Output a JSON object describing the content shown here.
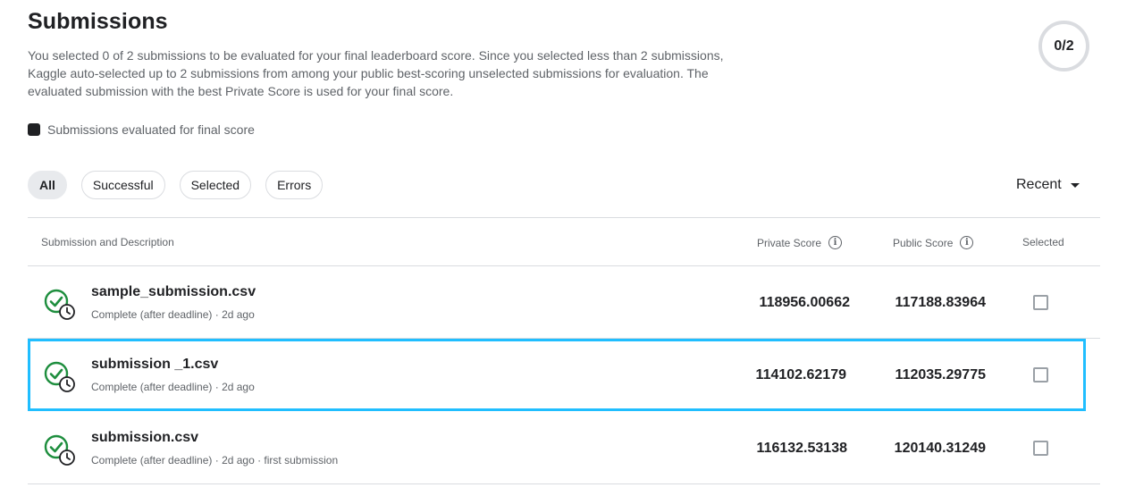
{
  "header": {
    "title": "Submissions",
    "description_lines": [
      "You selected 0 of 2 submissions to be evaluated for your final leaderboard score. Since you selected less than 2 submissions,",
      "Kaggle auto-selected up to 2 submissions from among your public best-scoring unselected submissions for evaluation. The",
      "evaluated submission with the best Private Score is used for your final score."
    ],
    "counter": "0/2"
  },
  "legend": {
    "label": "Submissions evaluated for final score"
  },
  "filters": [
    {
      "label": "All",
      "active": true
    },
    {
      "label": "Successful",
      "active": false
    },
    {
      "label": "Selected",
      "active": false
    },
    {
      "label": "Errors",
      "active": false
    }
  ],
  "sort": {
    "label": "Recent"
  },
  "table": {
    "columns": {
      "submission": "Submission and Description",
      "private_score": "Private Score",
      "public_score": "Public Score",
      "selected": "Selected"
    },
    "rows": [
      {
        "name": "sample_submission.csv",
        "meta": "Complete (after deadline) · 2d ago",
        "private_score": "118956.00662",
        "public_score": "117188.83964",
        "selected": false
      },
      {
        "name": "submission _1.csv",
        "meta": "Complete (after deadline) · 2d ago",
        "private_score": "114102.62179",
        "public_score": "112035.29775",
        "selected": false
      },
      {
        "name": "submission.csv",
        "meta": "Complete (after deadline) · 2d ago · first submission",
        "private_score": "116132.53138",
        "public_score": "120140.31249",
        "selected": false
      }
    ]
  },
  "colors": {
    "success_green": "#1e8e3e",
    "highlight_blue": "#20beff",
    "border": "#dadce0"
  }
}
